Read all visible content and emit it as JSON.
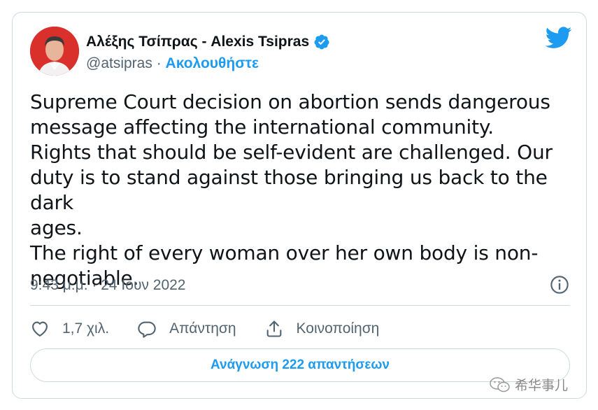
{
  "author": {
    "name": "Αλέξης Τσίπρας - Alexis Tsipras",
    "handle": "@atsipras",
    "separator": "·",
    "follow_label": "Ακολουθήστε",
    "verified_icon": "verified-badge-icon"
  },
  "tweet": {
    "text": "Supreme Court decision on abortion sends dangerous\nmessage affecting the international community.\nRights that should be self-evident are challenged. Our\nduty is to stand against those bringing us back to the dark\nages.\nThe right of every woman over her own body is non-\nnegotiable.",
    "timestamp": "9:43 μ.μ. · 24 Ιουν 2022"
  },
  "actions": {
    "like_count": "1,7 χιλ.",
    "reply_label": "Απάντηση",
    "share_label": "Κοινοποίηση"
  },
  "replies_button": {
    "label": "Ανάγνωση 222 απαντήσεων"
  },
  "watermark": {
    "text": "希华事儿"
  },
  "colors": {
    "accent": "#1d9bf0",
    "secondary_text": "#536471",
    "border": "#cfd9de"
  }
}
